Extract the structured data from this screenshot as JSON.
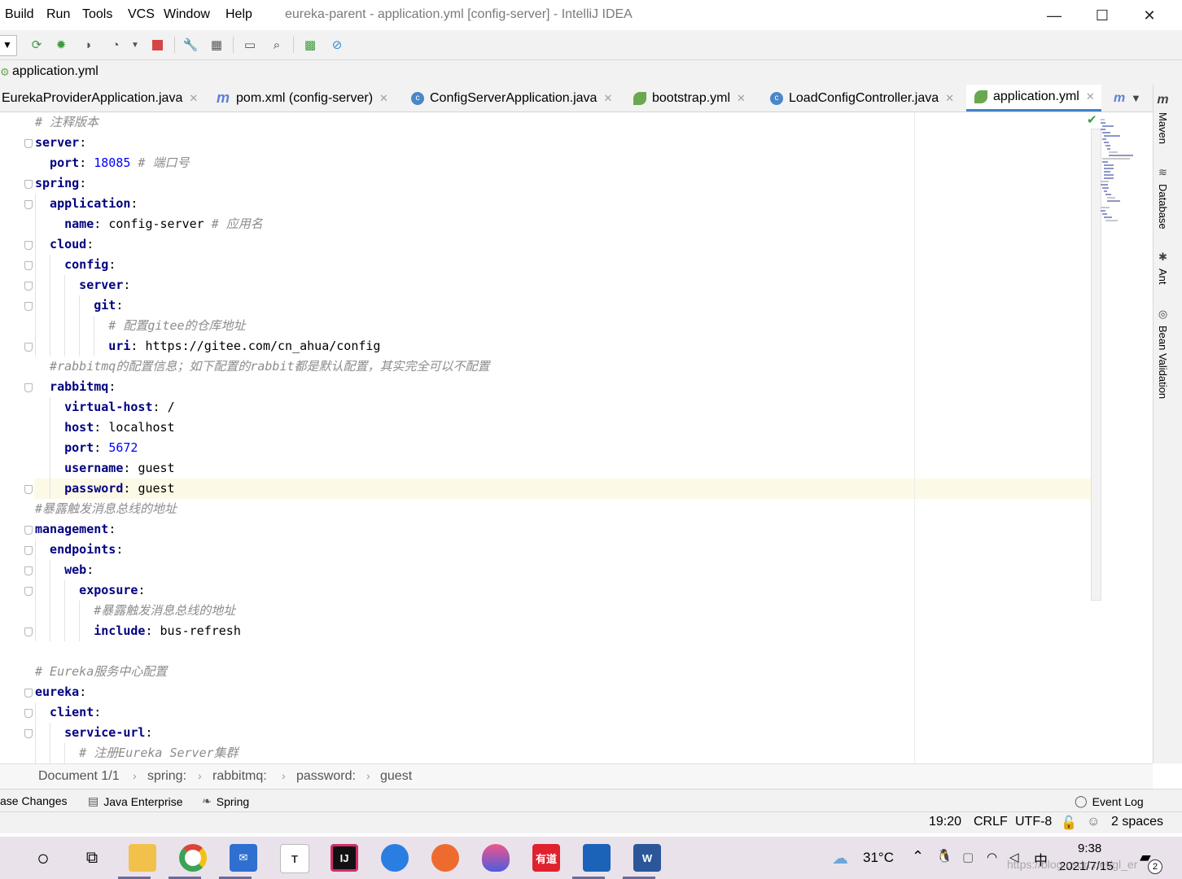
{
  "menu": [
    "Build",
    "Run",
    "Tools",
    "VCS",
    "Window",
    "Help"
  ],
  "window_title": "eureka-parent - application.yml [config-server] - IntelliJ IDEA",
  "window_controls": {
    "minimize": "—",
    "maximize": "☐",
    "close": "✕"
  },
  "nav": {
    "file": "application.yml"
  },
  "tabs": [
    {
      "label": "EurekaProviderApplication.java",
      "close": "✕"
    },
    {
      "label": "pom.xml (config-server)",
      "close": "✕",
      "icon_letter": "m"
    },
    {
      "label": "ConfigServerApplication.java",
      "close": "✕",
      "icon_letter": "c"
    },
    {
      "label": "bootstrap.yml",
      "close": "✕"
    },
    {
      "label": "LoadConfigController.java",
      "close": "✕",
      "icon_letter": "c"
    },
    {
      "label": "application.yml",
      "close": "✕"
    }
  ],
  "tabs_overflow": "m",
  "editor_lines": [
    [
      {
        "t": "# 注释版本",
        "s": "c"
      }
    ],
    [
      {
        "t": "server",
        "s": "k"
      },
      {
        "t": ":",
        "s": "p"
      }
    ],
    [
      {
        "t": "  port",
        "s": "k"
      },
      {
        "t": ": ",
        "s": "p"
      },
      {
        "t": "18085",
        "s": "n"
      },
      {
        "t": " # 端口号",
        "s": "c"
      }
    ],
    [
      {
        "t": "spring",
        "s": "k"
      },
      {
        "t": ":",
        "s": "p"
      }
    ],
    [
      {
        "t": "  application",
        "s": "k"
      },
      {
        "t": ":",
        "s": "p"
      }
    ],
    [
      {
        "t": "    name",
        "s": "k"
      },
      {
        "t": ": ",
        "s": "p"
      },
      {
        "t": "config-server",
        "s": "v"
      },
      {
        "t": " # 应用名",
        "s": "c"
      }
    ],
    [
      {
        "t": "  cloud",
        "s": "k"
      },
      {
        "t": ":",
        "s": "p"
      }
    ],
    [
      {
        "t": "    config",
        "s": "k"
      },
      {
        "t": ":",
        "s": "p"
      }
    ],
    [
      {
        "t": "      server",
        "s": "k"
      },
      {
        "t": ":",
        "s": "p"
      }
    ],
    [
      {
        "t": "        git",
        "s": "k"
      },
      {
        "t": ":",
        "s": "p"
      }
    ],
    [
      {
        "t": "          # 配置gitee的仓库地址",
        "s": "c"
      }
    ],
    [
      {
        "t": "          uri",
        "s": "k"
      },
      {
        "t": ": ",
        "s": "p"
      },
      {
        "t": "https://gitee.com/cn_ahua/config",
        "s": "v"
      }
    ],
    [
      {
        "t": "  #rabbitmq的配置信息；如下配置的rabbit都是默认配置，其实完全可以不配置",
        "s": "c"
      }
    ],
    [
      {
        "t": "  rabbitmq",
        "s": "k"
      },
      {
        "t": ":",
        "s": "p"
      }
    ],
    [
      {
        "t": "    virtual-host",
        "s": "k"
      },
      {
        "t": ": ",
        "s": "p"
      },
      {
        "t": "/",
        "s": "v"
      }
    ],
    [
      {
        "t": "    host",
        "s": "k"
      },
      {
        "t": ": ",
        "s": "p"
      },
      {
        "t": "localhost",
        "s": "v"
      }
    ],
    [
      {
        "t": "    port",
        "s": "k"
      },
      {
        "t": ": ",
        "s": "p"
      },
      {
        "t": "5672",
        "s": "n"
      }
    ],
    [
      {
        "t": "    username",
        "s": "k"
      },
      {
        "t": ": ",
        "s": "p"
      },
      {
        "t": "guest",
        "s": "v"
      }
    ],
    [
      {
        "t": "    password",
        "s": "k"
      },
      {
        "t": ": ",
        "s": "p"
      },
      {
        "t": "guest",
        "s": "v"
      }
    ],
    [
      {
        "t": "#暴露触发消息总线的地址",
        "s": "c"
      }
    ],
    [
      {
        "t": "management",
        "s": "k"
      },
      {
        "t": ":",
        "s": "p"
      }
    ],
    [
      {
        "t": "  endpoints",
        "s": "k"
      },
      {
        "t": ":",
        "s": "p"
      }
    ],
    [
      {
        "t": "    web",
        "s": "k"
      },
      {
        "t": ":",
        "s": "p"
      }
    ],
    [
      {
        "t": "      exposure",
        "s": "k"
      },
      {
        "t": ":",
        "s": "p"
      }
    ],
    [
      {
        "t": "        #暴露触发消息总线的地址",
        "s": "c"
      }
    ],
    [
      {
        "t": "        include",
        "s": "k"
      },
      {
        "t": ": ",
        "s": "p"
      },
      {
        "t": "bus-refresh",
        "s": "v"
      }
    ],
    [],
    [
      {
        "t": "# Eureka服务中心配置",
        "s": "c"
      }
    ],
    [
      {
        "t": "eureka",
        "s": "k"
      },
      {
        "t": ":",
        "s": "p"
      }
    ],
    [
      {
        "t": "  client",
        "s": "k"
      },
      {
        "t": ":",
        "s": "p"
      }
    ],
    [
      {
        "t": "    service-url",
        "s": "k"
      },
      {
        "t": ":",
        "s": "p"
      }
    ],
    [
      {
        "t": "      # 注册Eureka Server集群",
        "s": "c"
      }
    ]
  ],
  "right_tools": [
    {
      "label": "Maven",
      "icon": "m"
    },
    {
      "label": "Database",
      "icon": "≋"
    },
    {
      "label": "Ant",
      "icon": "✱"
    },
    {
      "label": "Bean Validation",
      "icon": "◎"
    }
  ],
  "breadcrumb": [
    "Document 1/1",
    "spring:",
    "rabbitmq:",
    "password:",
    "guest"
  ],
  "breadcrumb_separator": "›",
  "tool_windows": [
    "ase Changes",
    "Java Enterprise",
    "Spring"
  ],
  "event_log": "Event Log",
  "status": {
    "position": "19:20",
    "line_sep": "CRLF",
    "encoding": "UTF-8",
    "indent": "2 spaces"
  },
  "taskbar": {
    "temperature": "31°C",
    "ime": "中",
    "time": "9:38",
    "date": "2021/7/15",
    "notifications": "2",
    "app_labels": [
      "T",
      "IJ",
      "有道",
      "W"
    ],
    "watermark": "https://blog.csdn.net/gl_er"
  }
}
